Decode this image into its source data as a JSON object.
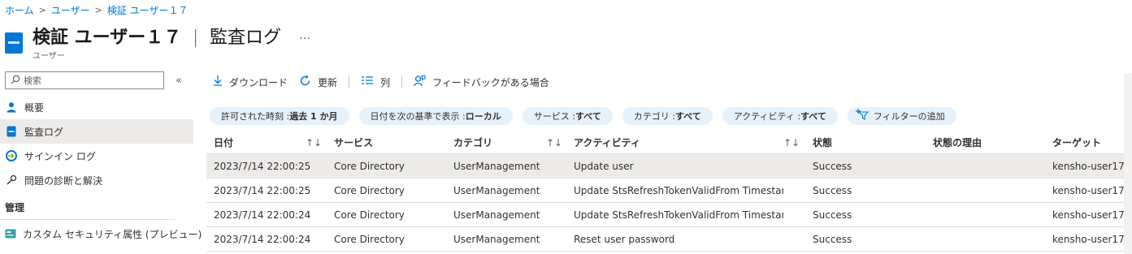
{
  "breadcrumb": {
    "items": [
      "ホーム",
      "ユーザー",
      "検証 ユーザー１７"
    ],
    "separator": ">"
  },
  "header": {
    "title_main": "検証 ユーザー１７",
    "title_pipe": "|",
    "title_sub": "監査ログ",
    "more": "…",
    "subtitle": "ユーザー"
  },
  "sidebar": {
    "search_placeholder": "検索",
    "collapse": "«",
    "items": [
      {
        "label": "概要",
        "icon": "user-icon",
        "active": false
      },
      {
        "label": "監査ログ",
        "icon": "audit-log-icon",
        "active": true
      },
      {
        "label": "サインイン ログ",
        "icon": "sign-in-icon",
        "active": false
      },
      {
        "label": "問題の診断と解決",
        "icon": "wrench-icon",
        "active": false
      }
    ],
    "section": "管理",
    "section_items": [
      {
        "label": "カスタム セキュリティ属性 (プレビュー)",
        "icon": "custom-attribute-icon"
      }
    ]
  },
  "toolbar": {
    "download": "ダウンロード",
    "refresh": "更新",
    "columns": "列",
    "feedback": "フィードバックがある場合"
  },
  "filters": {
    "pills": [
      {
        "label": "許可された時刻 : ",
        "value": "過去 1 か月"
      },
      {
        "label": "日付を次の基準で表示 : ",
        "value": "ローカル"
      },
      {
        "label": "サービス : ",
        "value": "すべて"
      },
      {
        "label": "カテゴリ : ",
        "value": "すべて"
      },
      {
        "label": "アクティビティ : ",
        "value": "すべて"
      }
    ],
    "add": "フィルターの追加"
  },
  "table": {
    "columns": {
      "date": "日付",
      "service": "サービス",
      "category": "カテゴリ",
      "activity": "アクティビティ",
      "status": "状態",
      "reason": "状態の理由",
      "target": "ターゲット"
    },
    "sort_glyph": "↑↓",
    "rows": [
      {
        "date": "2023/7/14 22:00:25",
        "service": "Core Directory",
        "category": "UserManagement",
        "activity": "Update user",
        "status": "Success",
        "reason": "",
        "target": "kensho-user17...",
        "selected": true
      },
      {
        "date": "2023/7/14 22:00:25",
        "service": "Core Directory",
        "category": "UserManagement",
        "activity": "Update StsRefreshTokenValidFrom Timestamp",
        "status": "Success",
        "reason": "",
        "target": "kensho-user17...",
        "selected": false
      },
      {
        "date": "2023/7/14 22:00:24",
        "service": "Core Directory",
        "category": "UserManagement",
        "activity": "Update StsRefreshTokenValidFrom Timestamp",
        "status": "Success",
        "reason": "",
        "target": "kensho-user17...",
        "selected": false
      },
      {
        "date": "2023/7/14 22:00:24",
        "service": "Core Directory",
        "category": "UserManagement",
        "activity": "Reset user password",
        "status": "Success",
        "reason": "",
        "target": "kensho-user17...",
        "selected": false
      }
    ]
  },
  "colors": {
    "accent": "#0078d4",
    "pill_bg": "#e5f1fb",
    "selected_bg": "#edebe9"
  }
}
